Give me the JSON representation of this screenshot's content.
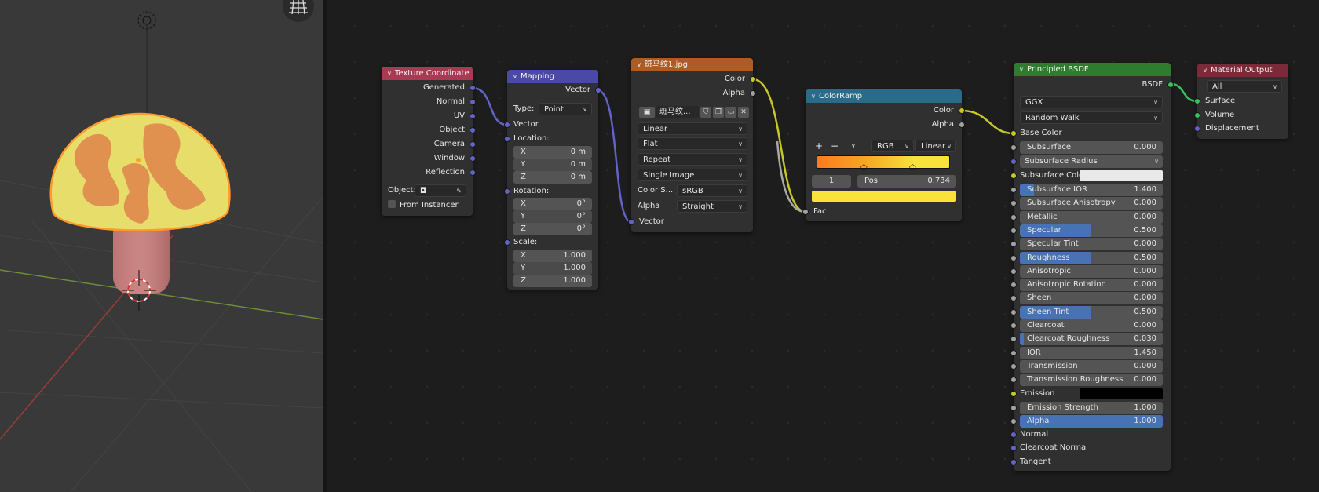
{
  "viewport": {
    "grid_icon": "grid-icon",
    "origin_icon": "empty-origin-icon",
    "cursor_icon": "3d-cursor-icon"
  },
  "nodes": {
    "texcoord": {
      "title": "Texture Coordinate",
      "outputs": [
        "Generated",
        "Normal",
        "UV",
        "Object",
        "Camera",
        "Window",
        "Reflection"
      ],
      "object_label": "Object:",
      "from_instancer": "From Instancer"
    },
    "mapping": {
      "title": "Mapping",
      "output": "Vector",
      "type_label": "Type:",
      "type_value": "Point",
      "vector_input": "Vector",
      "location_label": "Location:",
      "location": [
        {
          "axis": "X",
          "value": "0 m"
        },
        {
          "axis": "Y",
          "value": "0 m"
        },
        {
          "axis": "Z",
          "value": "0 m"
        }
      ],
      "rotation_label": "Rotation:",
      "rotation": [
        {
          "axis": "X",
          "value": "0°"
        },
        {
          "axis": "Y",
          "value": "0°"
        },
        {
          "axis": "Z",
          "value": "0°"
        }
      ],
      "scale_label": "Scale:",
      "scale": [
        {
          "axis": "X",
          "value": "1.000"
        },
        {
          "axis": "Y",
          "value": "1.000"
        },
        {
          "axis": "Z",
          "value": "1.000"
        }
      ]
    },
    "image": {
      "title": "斑马纹1.jpg",
      "outputs": [
        "Color",
        "Alpha"
      ],
      "image_name": "斑马纹...",
      "interpolation": "Linear",
      "projection": "Flat",
      "extension": "Repeat",
      "source": "Single Image",
      "colorspace_label": "Color S...",
      "colorspace_value": "sRGB",
      "alpha_label": "Alpha",
      "alpha_value": "Straight",
      "vector_input": "Vector"
    },
    "colorramp": {
      "title": "ColorRamp",
      "outputs": [
        "Color",
        "Alpha"
      ],
      "add": "+",
      "remove": "−",
      "mode": "RGB",
      "interp": "Linear",
      "index": "1",
      "pos_label": "Pos",
      "pos_value": "0.734",
      "fac_input": "Fac",
      "stops": [
        {
          "pos": 0.0,
          "color": "#ff7a1f"
        },
        {
          "pos": 0.36,
          "color": "#f4a623"
        },
        {
          "pos": 0.734,
          "color": "#f9e23a"
        },
        {
          "pos": 1.0,
          "color": "#f9e23a"
        }
      ],
      "selected_color": "#f9e23a"
    },
    "bsdf": {
      "title": "Principled BSDF",
      "output": "BSDF",
      "distribution": "GGX",
      "subsurface_method": "Random Walk",
      "base_color_label": "Base Color",
      "subsurface": {
        "label": "Subsurface",
        "value": "0.000"
      },
      "subsurface_radius": "Subsurface Radius",
      "subsurface_color_label": "Subsurface Color",
      "subsurface_color": "#e9e9e9",
      "params": [
        {
          "label": "Subsurface IOR",
          "value": "1.400",
          "fill": 0.1
        },
        {
          "label": "Subsurface Anisotropy",
          "value": "0.000",
          "fill": 0
        },
        {
          "label": "Metallic",
          "value": "0.000",
          "fill": 0
        },
        {
          "label": "Specular",
          "value": "0.500",
          "fill": 0.5
        },
        {
          "label": "Specular Tint",
          "value": "0.000",
          "fill": 0
        },
        {
          "label": "Roughness",
          "value": "0.500",
          "fill": 0.5
        },
        {
          "label": "Anisotropic",
          "value": "0.000",
          "fill": 0
        },
        {
          "label": "Anisotropic Rotation",
          "value": "0.000",
          "fill": 0
        },
        {
          "label": "Sheen",
          "value": "0.000",
          "fill": 0
        },
        {
          "label": "Sheen Tint",
          "value": "0.500",
          "fill": 0.5
        },
        {
          "label": "Clearcoat",
          "value": "0.000",
          "fill": 0
        },
        {
          "label": "Clearcoat Roughness",
          "value": "0.030",
          "fill": 0.03
        },
        {
          "label": "IOR",
          "value": "1.450",
          "fill": 0
        },
        {
          "label": "Transmission",
          "value": "0.000",
          "fill": 0
        },
        {
          "label": "Transmission Roughness",
          "value": "0.000",
          "fill": 0
        }
      ],
      "emission_label": "Emission",
      "emission_color": "#000000",
      "emission_strength": {
        "label": "Emission Strength",
        "value": "1.000"
      },
      "alpha": {
        "label": "Alpha",
        "value": "1.000",
        "fill": 1.0
      },
      "vector_inputs": [
        "Normal",
        "Clearcoat Normal",
        "Tangent"
      ]
    },
    "output": {
      "title": "Material Output",
      "target": "All",
      "inputs": [
        "Surface",
        "Volume",
        "Displacement"
      ]
    }
  },
  "colors": {
    "texcoord_header": "#a83a54",
    "mapping_header": "#4a4aa6",
    "image_header": "#b05b21",
    "colorramp_header": "#2b6b8a",
    "bsdf_header": "#2e7d2e",
    "output_header": "#7a2a38"
  }
}
